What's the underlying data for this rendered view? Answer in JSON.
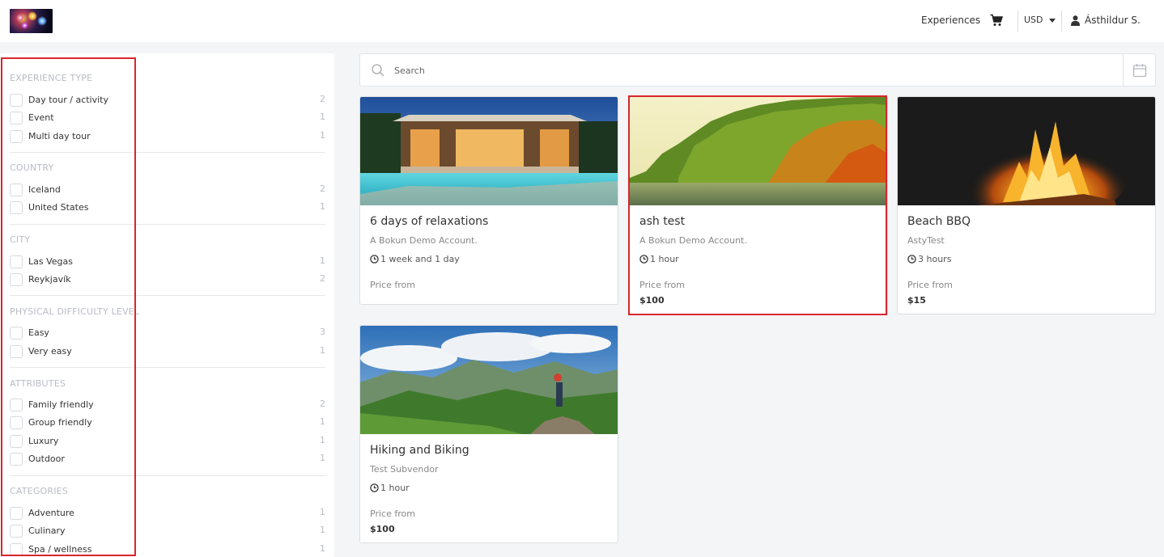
{
  "header": {
    "logo": "fireworks-logo",
    "nav_experiences": "Experiences",
    "cart_icon": "cart-icon",
    "currency": "USD",
    "user_name": "Ásthildur S."
  },
  "sidebar": {
    "sections": [
      {
        "title": "EXPERIENCE TYPE",
        "options": [
          {
            "label": "Day tour / activity",
            "count": "2"
          },
          {
            "label": "Event",
            "count": "1"
          },
          {
            "label": "Multi day tour",
            "count": "1"
          }
        ]
      },
      {
        "title": "COUNTRY",
        "options": [
          {
            "label": "Iceland",
            "count": "2"
          },
          {
            "label": "United States",
            "count": "1"
          }
        ]
      },
      {
        "title": "CITY",
        "options": [
          {
            "label": "Las Vegas",
            "count": "1"
          },
          {
            "label": "Reykjavík",
            "count": "2"
          }
        ]
      },
      {
        "title": "PHYSICAL DIFFICULTY LEVEL",
        "options": [
          {
            "label": "Easy",
            "count": "3"
          },
          {
            "label": "Very easy",
            "count": "1"
          }
        ]
      },
      {
        "title": "ATTRIBUTES",
        "options": [
          {
            "label": "Family friendly",
            "count": "2"
          },
          {
            "label": "Group friendly",
            "count": "1"
          },
          {
            "label": "Luxury",
            "count": "1"
          },
          {
            "label": "Outdoor",
            "count": "1"
          }
        ]
      },
      {
        "title": "CATEGORIES",
        "options": [
          {
            "label": "Adventure",
            "count": "1"
          },
          {
            "label": "Culinary",
            "count": "1"
          },
          {
            "label": "Spa / wellness",
            "count": "1"
          }
        ]
      }
    ]
  },
  "search": {
    "placeholder": "Search",
    "value": ""
  },
  "products": [
    {
      "title": "6 days of relaxations",
      "vendor": "A Bokun Demo Account.",
      "duration": "1 week and 1 day",
      "price_label": "Price from",
      "price": "",
      "image": "luxury-villa-pool-photo"
    },
    {
      "title": "ash test",
      "vendor": "A Bokun Demo Account.",
      "duration": "1 hour",
      "price_label": "Price from",
      "price": "$100",
      "image": "autumn-forest-river-photo"
    },
    {
      "title": "Beach BBQ",
      "vendor": "AstyTest",
      "duration": "3 hours",
      "price_label": "Price from",
      "price": "$15",
      "image": "bonfire-night-photo"
    },
    {
      "title": "Hiking and Biking",
      "vendor": "Test Subvendor",
      "duration": "1 hour",
      "price_label": "Price from",
      "price": "$100",
      "image": "mountain-hiker-photo"
    }
  ],
  "colors": {
    "highlight_box": "#d9262c",
    "page_background": "#f4f5f7",
    "muted_text": "#b9bcc3"
  }
}
